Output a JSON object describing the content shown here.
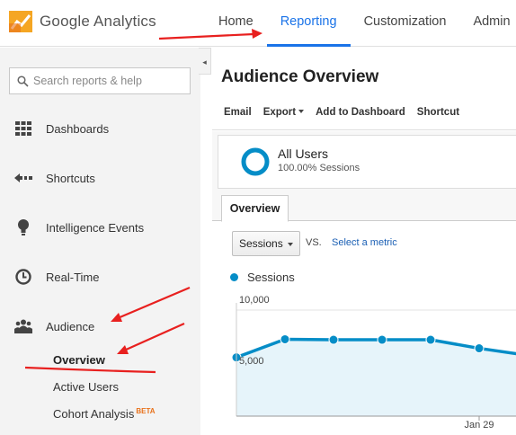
{
  "header": {
    "brand": "Google Analytics",
    "nav": [
      {
        "label": "Home",
        "active": false
      },
      {
        "label": "Reporting",
        "active": true
      },
      {
        "label": "Customization",
        "active": false
      },
      {
        "label": "Admin",
        "active": false
      }
    ]
  },
  "sidebar": {
    "collapse_icon": "◂",
    "search_placeholder": "Search reports & help",
    "items": [
      {
        "label": "Dashboards",
        "icon": "grid-icon"
      },
      {
        "label": "Shortcuts",
        "icon": "shortcut-arrow-icon"
      },
      {
        "label": "Intelligence Events",
        "icon": "lightbulb-icon"
      },
      {
        "label": "Real-Time",
        "icon": "clock-icon"
      },
      {
        "label": "Audience",
        "icon": "people-icon"
      }
    ],
    "subitems": [
      {
        "label": "Overview",
        "active": true
      },
      {
        "label": "Active Users",
        "active": false
      },
      {
        "label": "Cohort Analysis",
        "badge": "BETA",
        "active": false
      }
    ]
  },
  "main": {
    "title": "Audience Overview",
    "toolbar": {
      "email": "Email",
      "export": "Export",
      "add_to_dashboard": "Add to Dashboard",
      "shortcut": "Shortcut"
    },
    "segment": {
      "name": "All Users",
      "detail": "100.00% Sessions"
    },
    "tab": "Overview",
    "metric": {
      "selected": "Sessions",
      "vs": "VS.",
      "select_metric": "Select a metric"
    },
    "legend": "Sessions"
  },
  "colors": {
    "accent": "#1a73e8",
    "series": "#058dc7",
    "area_fill": "#e6f4fa",
    "annotation": "#e8201f"
  },
  "chart_data": {
    "type": "line",
    "series": [
      {
        "name": "Sessions",
        "values": [
          5300,
          7100,
          7050,
          7050,
          7050,
          6200,
          5500
        ]
      }
    ],
    "y_ticks": [
      "10,000",
      "5,000"
    ],
    "ylim": [
      0,
      10000
    ],
    "x_tick_label": "Jan 29",
    "grid": true
  }
}
